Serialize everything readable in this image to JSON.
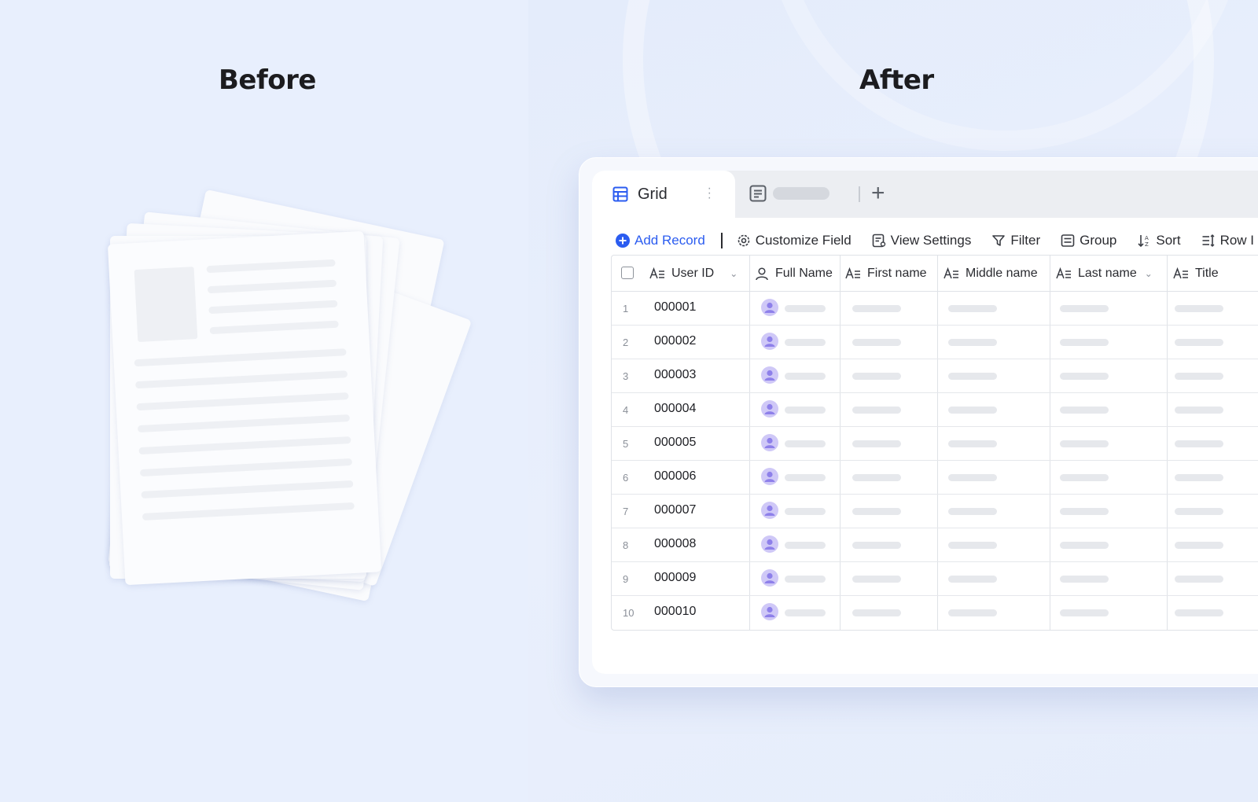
{
  "headings": {
    "before": "Before",
    "after": "After"
  },
  "tabs": [
    {
      "label": "Grid",
      "icon": "grid-table-icon",
      "active": true
    },
    {
      "label": "",
      "icon": "form-view-icon",
      "active": false
    }
  ],
  "toolbar": {
    "add_record": "Add Record",
    "customize_field": "Customize Field",
    "view_settings": "View Settings",
    "filter": "Filter",
    "group": "Group",
    "sort": "Sort",
    "row_height": "Row I"
  },
  "columns": [
    "User ID",
    "Full Name",
    "First name",
    "Middle name",
    "Last name",
    "Title"
  ],
  "rows": [
    {
      "num": "1",
      "user_id": "000001"
    },
    {
      "num": "2",
      "user_id": "000002"
    },
    {
      "num": "3",
      "user_id": "000003"
    },
    {
      "num": "4",
      "user_id": "000004"
    },
    {
      "num": "5",
      "user_id": "000005"
    },
    {
      "num": "6",
      "user_id": "000006"
    },
    {
      "num": "7",
      "user_id": "000007"
    },
    {
      "num": "8",
      "user_id": "000008"
    },
    {
      "num": "9",
      "user_id": "000009"
    },
    {
      "num": "10",
      "user_id": "000010"
    }
  ],
  "colors": {
    "accent": "#2b5cf0",
    "avatar": "#cfc8f7",
    "avatar_figure": "#8e80ea"
  }
}
